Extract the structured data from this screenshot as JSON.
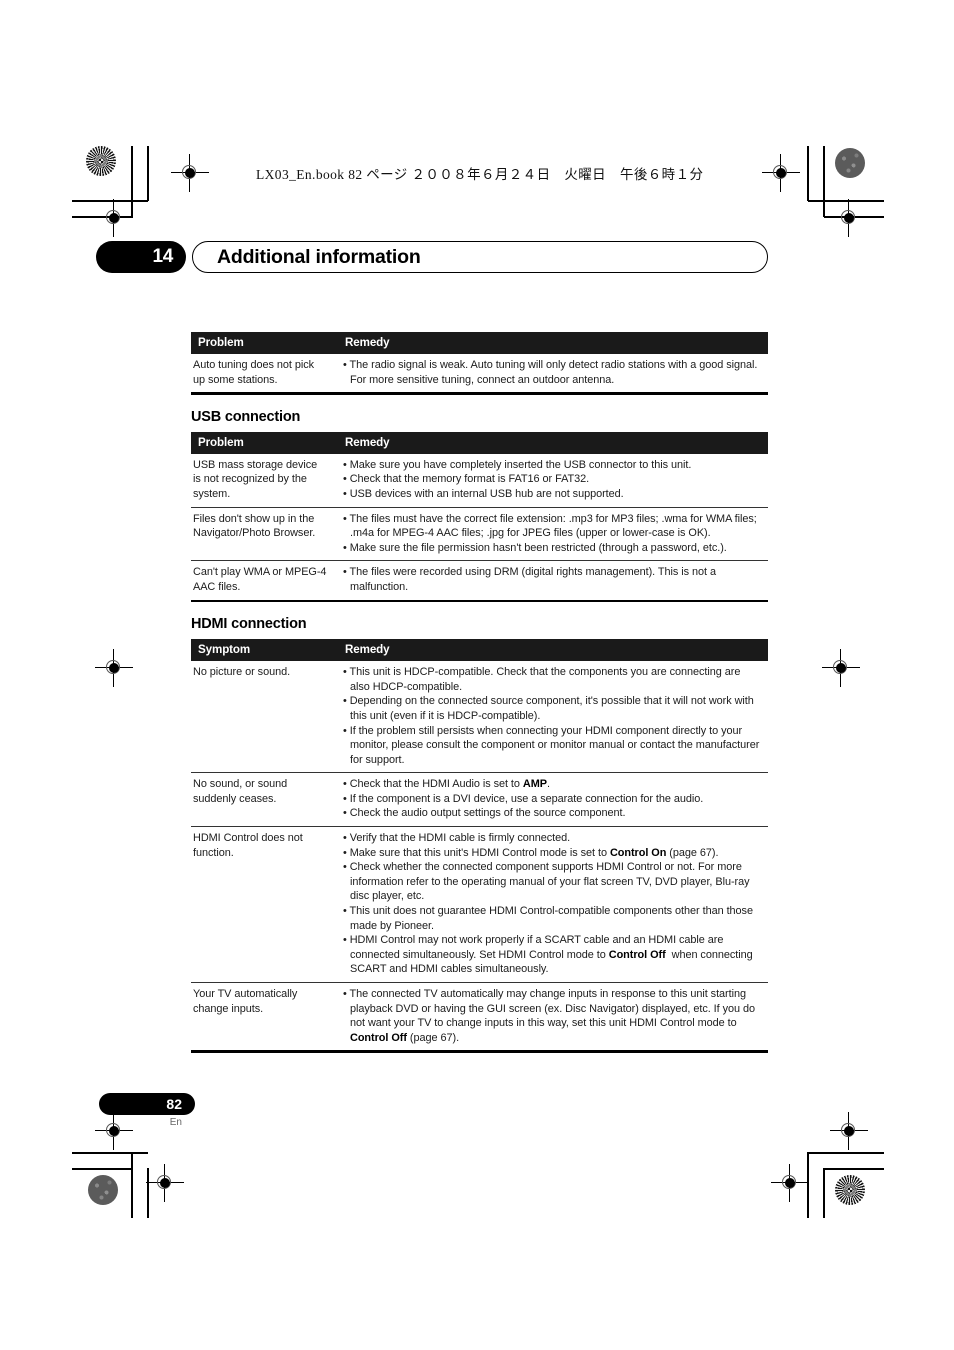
{
  "print_header": {
    "book_line": "LX03_En.book  82 ページ  ２００８年６月２４日　火曜日　午後６時１分"
  },
  "chapter": {
    "number": "14",
    "title": "Additional information"
  },
  "footer": {
    "page_number": "82",
    "language_code": "En"
  },
  "tables": [
    {
      "id": "tuner-table",
      "section_title": null,
      "headers": [
        "Problem",
        "Remedy"
      ],
      "rows": [
        {
          "problem": "Auto tuning does not pick up some stations.",
          "remedy": [
            "• The radio signal is weak. Auto tuning will only detect radio stations with a good signal. For more sensitive tuning, connect an outdoor antenna."
          ]
        }
      ]
    },
    {
      "id": "usb-table",
      "section_title": "USB connection",
      "headers": [
        "Problem",
        "Remedy"
      ],
      "rows": [
        {
          "problem": "USB mass storage device is not recognized by the system.",
          "remedy": [
            "• Make sure you have completely inserted the USB connector to this unit.",
            "• Check that the memory format is FAT16 or FAT32.",
            "• USB devices with an internal USB hub are not supported."
          ]
        },
        {
          "problem": "Files don't show up in the Navigator/Photo Browser.",
          "remedy": [
            "• The files must have the correct file extension: .mp3 for MP3 files; .wma for WMA files; .m4a for MPEG-4 AAC files; .jpg for JPEG files (upper or lower-case is OK).",
            "• Make sure the file permission hasn't been restricted (through a password, etc.)."
          ]
        },
        {
          "problem": "Can't play WMA or MPEG-4 AAC files.",
          "remedy": [
            "• The files were recorded using DRM (digital rights management). This is not a malfunction."
          ]
        }
      ]
    },
    {
      "id": "hdmi-table",
      "section_title": "HDMI connection",
      "headers": [
        "Symptom",
        "Remedy"
      ],
      "rows": [
        {
          "problem": "No picture or sound.",
          "remedy_html": [
            "• This unit is HDCP-compatible. Check that the components you are connecting are also HDCP-compatible.",
            "• Depending on the connected source component, it's possible that it will not work with this unit (even if it is HDCP-compatible).",
            "• If the problem still persists when connecting your HDMI component directly to your monitor, please consult the component or monitor manual or contact the manufacturer for support."
          ]
        },
        {
          "problem": "No sound, or sound suddenly ceases.",
          "remedy_html": [
            "• Check that the HDMI Audio is set to <b>AMP</b>.",
            "• If the component is a DVI device, use a separate connection for the audio.",
            "• Check the audio output settings of the source component."
          ]
        },
        {
          "problem": "HDMI Control does not function.",
          "remedy_html": [
            "• Verify that the HDMI cable is firmly connected.",
            "• Make sure that this unit's HDMI Control mode is set to <b>Control On</b> (page 67).",
            "• Check whether the connected component supports HDMI Control or not. For more information refer to the operating manual of your flat screen TV, DVD player, Blu-ray disc player, etc.",
            "• This unit does not guarantee HDMI Control-compatible components other than those made by Pioneer.",
            "• HDMI Control may not work properly if a SCART cable and an HDMI cable are connected simultaneously. Set HDMI Control mode to <b>Control Off</b>&nbsp; when connecting SCART and HDMI cables simultaneously."
          ]
        },
        {
          "problem": "Your TV automatically change inputs.",
          "remedy_html": [
            "• The connected TV automatically may change inputs in response to this unit starting playback DVD or having the GUI screen (ex. Disc Navigator) displayed, etc. If you do not want your TV to change inputs in this way, set this unit HDMI Control mode to <b>Control Off</b> (page 67)."
          ]
        }
      ]
    }
  ]
}
